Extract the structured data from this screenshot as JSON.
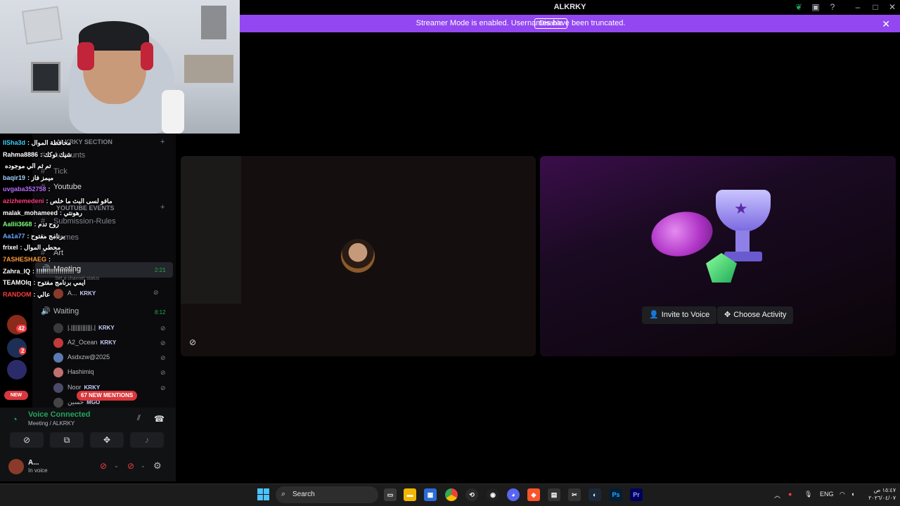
{
  "window": {
    "title": "ALKRKY"
  },
  "banner": {
    "text": "Streamer Mode is enabled. Usernames have been truncated.",
    "button": "Disable"
  },
  "sidebar": {
    "section": "ALKRKY SECTION",
    "channels": [
      {
        "name": "Accounts",
        "type": "text"
      },
      {
        "name": "Tick",
        "type": "text"
      },
      {
        "name": "Youtube",
        "type": "text"
      }
    ],
    "section2": "YOUTUBE EVENTS",
    "channels2": [
      {
        "name": "Submission-Rules",
        "type": "text"
      },
      {
        "name": "Memes",
        "type": "text"
      },
      {
        "name": "Art",
        "type": "text"
      }
    ],
    "meeting": {
      "name": "Meeting",
      "time": "2:21",
      "status": "Set a channel status"
    },
    "meeting_user": {
      "name": "A...",
      "tag": "KRKY"
    },
    "waiting": {
      "name": "Waiting",
      "time": "8:12"
    },
    "waiting_users": [
      {
        "name": "|.|||||||||||||.|",
        "tag": "KRKY"
      },
      {
        "name": "A2_Ocean",
        "tag": "KRKY"
      },
      {
        "name": "Asdxzw@2025",
        "tag": ""
      },
      {
        "name": "Hashimiq",
        "tag": ""
      },
      {
        "name": "Noor",
        "tag": "KRKY"
      },
      {
        "name": "حسين",
        "tag": "MGO"
      }
    ]
  },
  "rail": {
    "badges": [
      "42",
      "2"
    ],
    "new_label": "NEW"
  },
  "mentions": "67 NEW MENTIONS",
  "chat": [
    {
      "user": "IISha3d",
      "msg": ": محافظة الموال",
      "color": "#3ad0ff"
    },
    {
      "user": "Rahma8886",
      "msg": ": شيك توكك",
      "color": "#ffffff"
    },
    {
      "user": "",
      "msg": "تم ثم الي موجوده",
      "color": "#ff4a4a"
    },
    {
      "user": "baqir19",
      "msg": ": ميمز فاز",
      "color": "#9fd2ff"
    },
    {
      "user": "uvgaba352758",
      "msg": ":",
      "color": "#b86bff"
    },
    {
      "user": "azizhemedeni",
      "msg": ": مافو لسى البث ما خلص",
      "color": "#ff3b7a"
    },
    {
      "user": "malak_mohameed",
      "msg": ": رهونتي",
      "color": "#ffffff"
    },
    {
      "user": "Aallii3668",
      "msg": ": روح تدم",
      "color": "#7dff7d"
    },
    {
      "user": "Aa1a77",
      "msg": ": برنامج مفتوح",
      "color": "#6aa8ff"
    },
    {
      "user": "frixel",
      "msg": ": محطي الموال",
      "color": "#ffffff"
    },
    {
      "user": "7ASHESHAEG",
      "msg": ":",
      "color": "#ff9a3c"
    },
    {
      "user": "Zahra_IQ",
      "msg": ": !!!!!!!!!!!!!!!!!!",
      "color": "#ffffff"
    },
    {
      "user": "TEAMOIq",
      "msg": ": ايمي برنامج مفتوح",
      "color": "#ffffff"
    },
    {
      "user": "RANDOM",
      "msg": ": عالي",
      "color": "#ff3b3b"
    }
  ],
  "voice": {
    "status": "Voice Connected",
    "location": "Meeting / ALKRKY",
    "user_name": "A...",
    "user_status": "In voice"
  },
  "stage": {
    "invite_label": "Invite to Voice",
    "activity_label": "Choose Activity"
  },
  "taskbar": {
    "search_placeholder": "Search",
    "lang": "ENG",
    "time": "١٥:٤٧ ص",
    "date": "٢٠٢٦/٠٤/٠٧"
  },
  "colors": {
    "accent": "#9347f0",
    "online": "#23a55a",
    "danger": "#da373c"
  }
}
